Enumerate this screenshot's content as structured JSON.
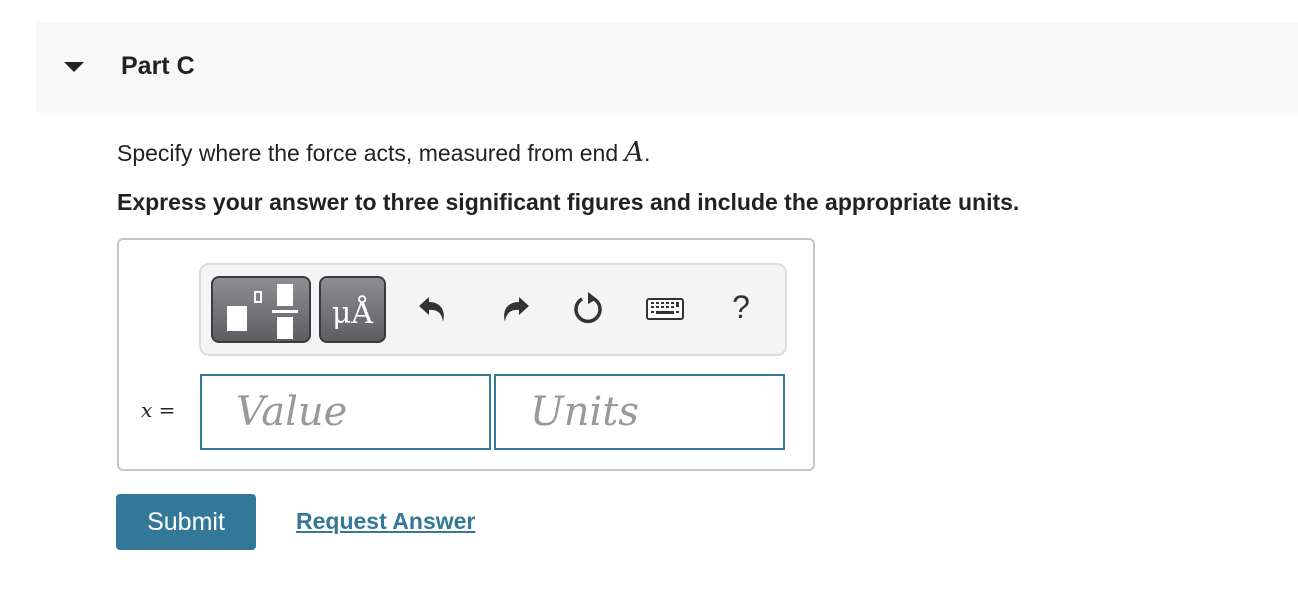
{
  "part": {
    "title": "Part C",
    "expanded": true
  },
  "question": {
    "prompt_text": "Specify where the force acts, measured from end ",
    "prompt_math": "A",
    "prompt_end": ".",
    "instruction": "Express your answer to three significant figures and include the appropriate units."
  },
  "toolbar": {
    "buttons": [
      {
        "name": "templates",
        "icon": "templates-icon"
      },
      {
        "name": "units",
        "label": "μÅ"
      },
      {
        "name": "undo",
        "icon": "undo-icon"
      },
      {
        "name": "redo",
        "icon": "redo-icon"
      },
      {
        "name": "reset",
        "icon": "reset-icon"
      },
      {
        "name": "keyboard",
        "icon": "keyboard-icon"
      },
      {
        "name": "help",
        "label": "?"
      }
    ]
  },
  "answer": {
    "variable": "x",
    "equals": "=",
    "value_placeholder": "Value",
    "value": "",
    "units_placeholder": "Units",
    "units": ""
  },
  "actions": {
    "submit_label": "Submit",
    "request_answer_label": "Request Answer"
  },
  "colors": {
    "accent": "#347899",
    "header_bg": "#f8f8f8",
    "toolbar_bg": "#f4f4f4"
  }
}
